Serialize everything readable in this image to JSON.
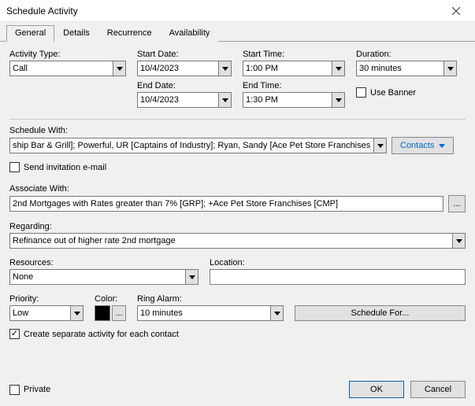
{
  "window": {
    "title": "Schedule Activity"
  },
  "tabs": {
    "t0": "General",
    "t1": "Details",
    "t2": "Recurrence",
    "t3": "Availability"
  },
  "activity_type": {
    "label": "Activity Type:",
    "value": "Call"
  },
  "start_date": {
    "label": "Start Date:",
    "value": "10/4/2023"
  },
  "end_date": {
    "label": "End Date:",
    "value": "10/4/2023"
  },
  "start_time": {
    "label": "Start Time:",
    "value": "1:00 PM"
  },
  "end_time": {
    "label": "End Time:",
    "value": "1:30 PM"
  },
  "duration": {
    "label": "Duration:",
    "value": "30 minutes"
  },
  "use_banner": {
    "label": "Use Banner"
  },
  "schedule_with": {
    "label": "Schedule With:",
    "value": "ship Bar & Grill]; Powerful, UR [Captains of Industry]; Ryan, Sandy [Ace Pet Store Franchises]",
    "button": "Contacts"
  },
  "send_invite": {
    "label": "Send invitation e-mail"
  },
  "associate_with": {
    "label": "Associate With:",
    "value": "2nd Mortgages with Rates greater than 7% [GRP]; +Ace Pet Store Franchises [CMP]",
    "button": "..."
  },
  "regarding": {
    "label": "Regarding:",
    "value": "Refinance out of higher rate 2nd mortgage"
  },
  "resources": {
    "label": "Resources:",
    "value": "None"
  },
  "location": {
    "label": "Location:",
    "value": ""
  },
  "priority": {
    "label": "Priority:",
    "value": "Low"
  },
  "color": {
    "label": "Color:",
    "value": "#000000",
    "button": "..."
  },
  "ring_alarm": {
    "label": "Ring Alarm:",
    "value": "10 minutes"
  },
  "schedule_for": {
    "label": "Schedule For..."
  },
  "create_separate": {
    "label": "Create separate activity for each contact"
  },
  "private": {
    "label": "Private"
  },
  "buttons": {
    "ok": "OK",
    "cancel": "Cancel"
  }
}
